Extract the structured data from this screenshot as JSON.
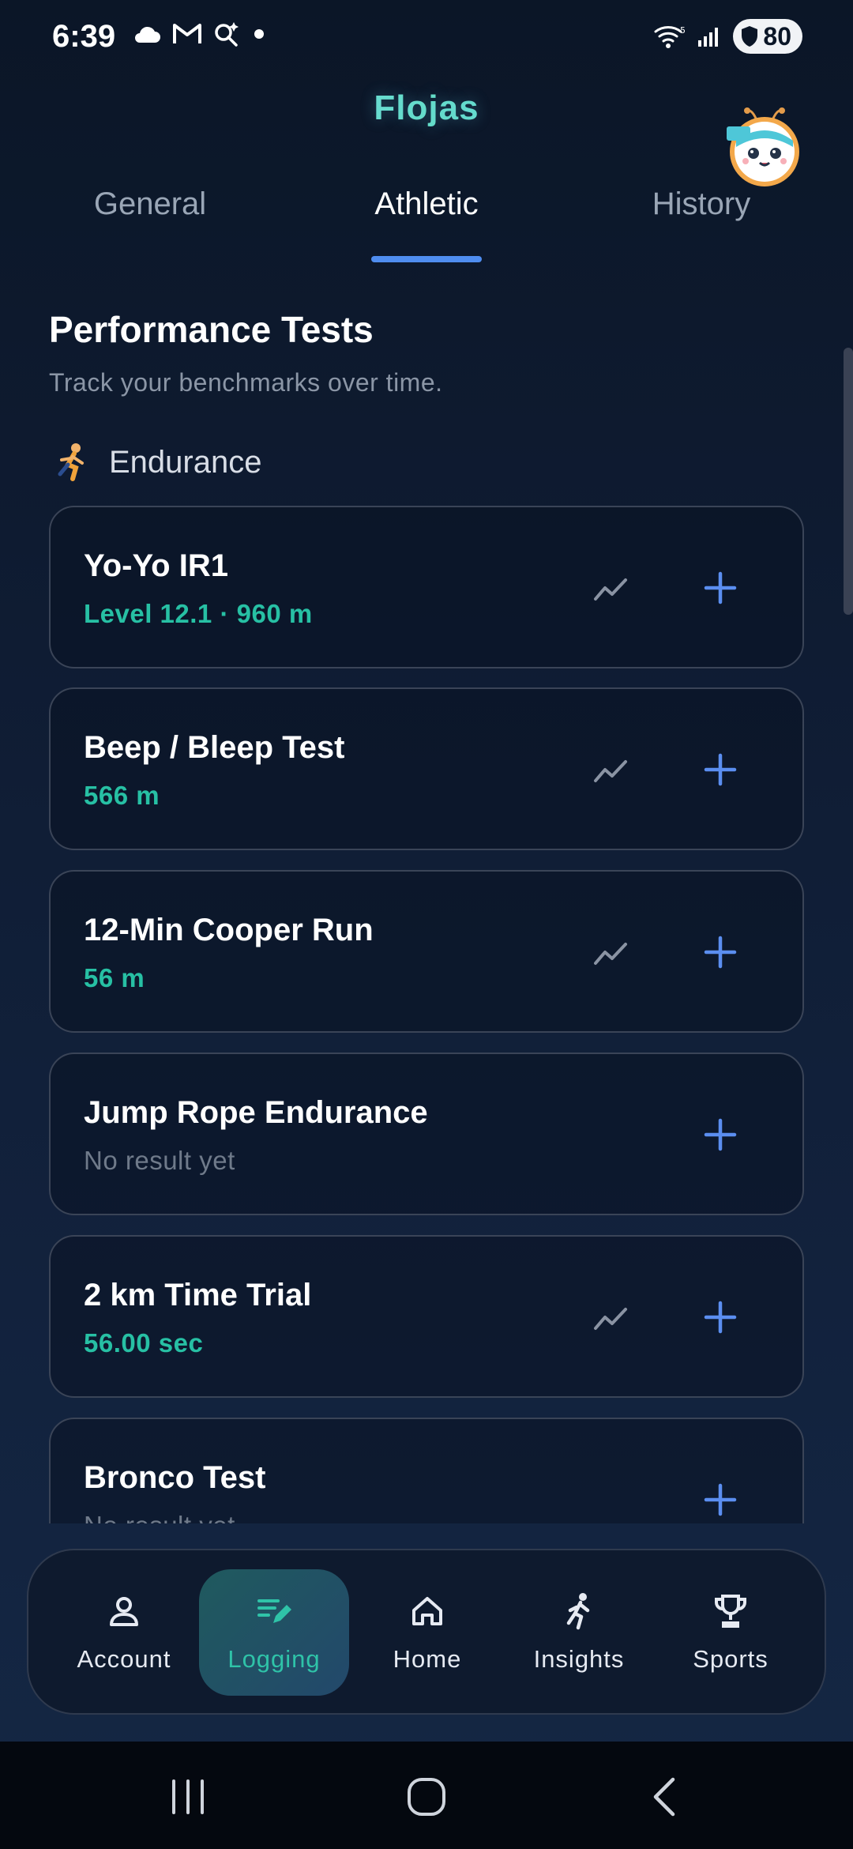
{
  "status": {
    "time": "6:39",
    "battery": "80",
    "wifi_label": "5"
  },
  "app": {
    "title": "Flojas"
  },
  "tabs": [
    {
      "label": "General"
    },
    {
      "label": "Athletic"
    },
    {
      "label": "History"
    }
  ],
  "section": {
    "title": "Performance Tests",
    "subtitle": "Track your benchmarks over time.",
    "category": "Endurance"
  },
  "tests": [
    {
      "name": "Yo-Yo IR1",
      "result": "Level 12.1  ·  960 m"
    },
    {
      "name": "Beep / Bleep Test",
      "result": "566 m"
    },
    {
      "name": "12-Min Cooper Run",
      "result": "56 m"
    },
    {
      "name": "Jump Rope Endurance",
      "result": "No result yet"
    },
    {
      "name": "2 km Time Trial",
      "result": "56.00 sec"
    },
    {
      "name": "Bronco Test",
      "result": "No result yet"
    }
  ],
  "nav": [
    {
      "label": "Account",
      "icon": "person-icon"
    },
    {
      "label": "Logging",
      "icon": "edit-list-icon"
    },
    {
      "label": "Home",
      "icon": "home-icon"
    },
    {
      "label": "Insights",
      "icon": "runner-icon"
    },
    {
      "label": "Sports",
      "icon": "trophy-icon"
    }
  ],
  "colors": {
    "accent": "#4f8df0",
    "result": "#27c0a4",
    "active_nav": "#2fc3a8"
  }
}
